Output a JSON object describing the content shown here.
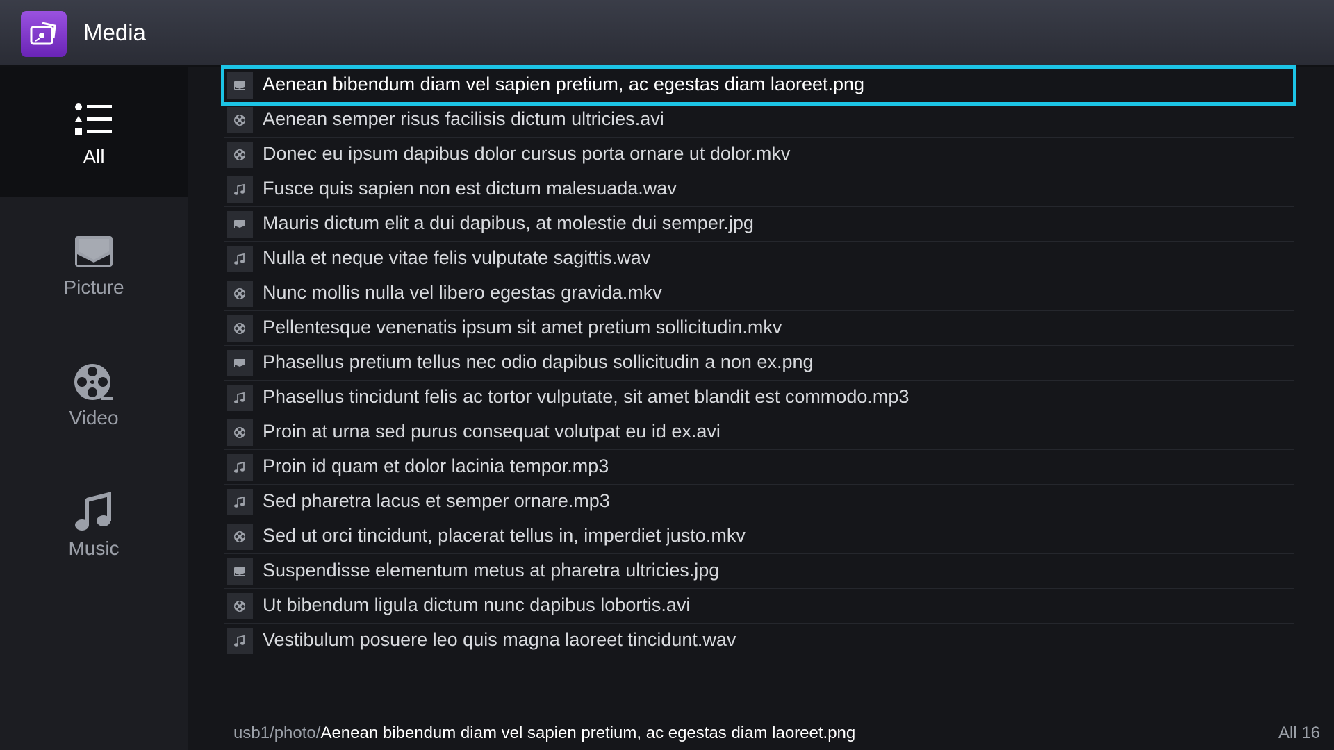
{
  "header": {
    "title": "Media",
    "logo_icon": "media-app-icon"
  },
  "sidebar": {
    "items": [
      {
        "label": "All",
        "icon": "list-icon",
        "active": true
      },
      {
        "label": "Picture",
        "icon": "picture-icon",
        "active": false
      },
      {
        "label": "Video",
        "icon": "film-reel-icon",
        "active": false
      },
      {
        "label": "Music",
        "icon": "music-note-icon",
        "active": false
      }
    ]
  },
  "files": [
    {
      "name": "Aenean bibendum diam vel sapien pretium, ac egestas diam laoreet.png",
      "type": "picture",
      "selected": true
    },
    {
      "name": "Aenean semper risus facilisis dictum ultricies.avi",
      "type": "video"
    },
    {
      "name": "Donec eu ipsum dapibus dolor cursus porta ornare ut dolor.mkv",
      "type": "video"
    },
    {
      "name": "Fusce quis sapien non est dictum malesuada.wav",
      "type": "music"
    },
    {
      "name": "Mauris dictum elit a dui dapibus, at molestie dui semper.jpg",
      "type": "picture"
    },
    {
      "name": "Nulla et neque vitae felis vulputate sagittis.wav",
      "type": "music"
    },
    {
      "name": "Nunc mollis nulla vel libero egestas gravida.mkv",
      "type": "video"
    },
    {
      "name": "Pellentesque venenatis ipsum sit amet pretium sollicitudin.mkv",
      "type": "video"
    },
    {
      "name": "Phasellus pretium tellus nec odio dapibus sollicitudin a non ex.png",
      "type": "picture"
    },
    {
      "name": "Phasellus tincidunt felis ac tortor vulputate, sit amet blandit est commodo.mp3",
      "type": "music"
    },
    {
      "name": "Proin at urna sed purus consequat volutpat eu id ex.avi",
      "type": "video"
    },
    {
      "name": "Proin id quam et dolor lacinia tempor.mp3",
      "type": "music"
    },
    {
      "name": "Sed pharetra lacus et semper ornare.mp3",
      "type": "music"
    },
    {
      "name": "Sed ut orci tincidunt, placerat tellus in, imperdiet justo.mkv",
      "type": "video"
    },
    {
      "name": "Suspendisse elementum metus at pharetra ultricies.jpg",
      "type": "picture"
    },
    {
      "name": "Ut bibendum ligula dictum nunc dapibus lobortis.avi",
      "type": "video"
    },
    {
      "name": "Vestibulum posuere leo quis magna laoreet tincidunt.wav",
      "type": "music"
    }
  ],
  "footer": {
    "path_prefix": "usb1/photo/",
    "path_file": "Aenean bibendum diam vel sapien pretium, ac egestas diam laoreet.png",
    "count_label": "All 16"
  },
  "colors": {
    "accent": "#1cc4e6",
    "logo": "#8a3fd6"
  }
}
